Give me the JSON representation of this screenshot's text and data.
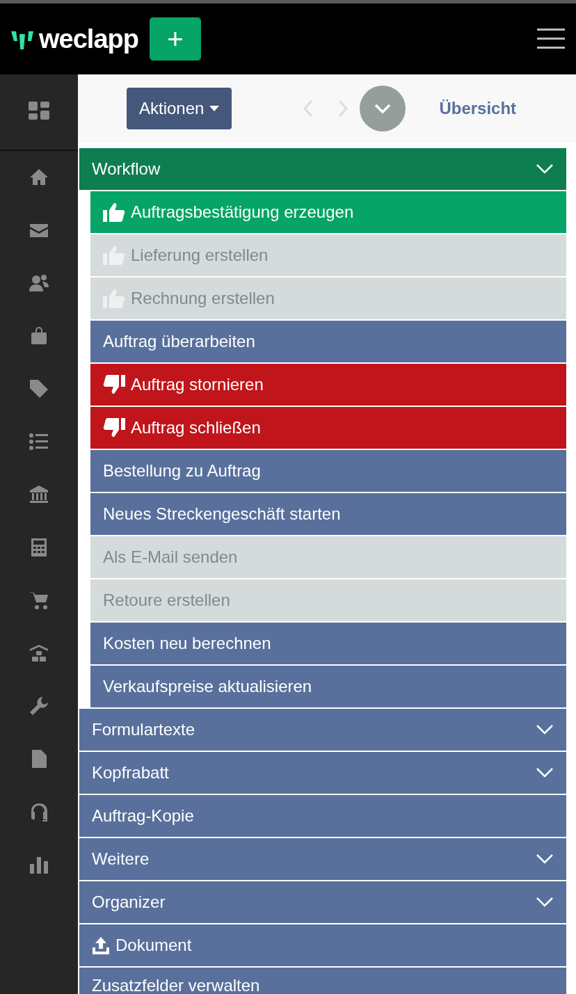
{
  "header": {
    "logo": "weclapp",
    "add_button": "+"
  },
  "toolbar": {
    "actions_button": "Aktionen",
    "previous_disabled": true,
    "next_disabled": true,
    "overview_link": "Übersicht"
  },
  "sections": [
    {
      "label": "Workflow",
      "collapsible": true,
      "expanded": true,
      "children": [
        {
          "label": "Auftragsbestätigung erzeugen",
          "kind": "approve",
          "disabled": false
        },
        {
          "label": "Lieferung erstellen",
          "kind": "approve",
          "disabled": true
        },
        {
          "label": "Rechnung erstellen",
          "kind": "approve",
          "disabled": true
        },
        {
          "label": "Auftrag überarbeiten",
          "kind": "primary",
          "disabled": false
        },
        {
          "label": "Auftrag stornieren",
          "kind": "reject",
          "disabled": false
        },
        {
          "label": "Auftrag schließen",
          "kind": "reject",
          "disabled": false
        },
        {
          "label": "Bestellung zu Auftrag",
          "kind": "primary",
          "disabled": false
        },
        {
          "label": "Neues Streckengeschäft starten",
          "kind": "primary",
          "disabled": false
        },
        {
          "label": "Als E-Mail senden",
          "kind": "primary",
          "disabled": true
        },
        {
          "label": "Retoure erstellen",
          "kind": "primary",
          "disabled": true
        },
        {
          "label": "Kosten neu berechnen",
          "kind": "primary",
          "disabled": false
        },
        {
          "label": "Verkaufspreise aktualisieren",
          "kind": "primary",
          "disabled": false
        }
      ]
    },
    {
      "label": "Formulartexte",
      "collapsible": true,
      "expanded": false
    },
    {
      "label": "Kopfrabatt",
      "collapsible": true,
      "expanded": false
    },
    {
      "label": "Auftrag-Kopie",
      "collapsible": false,
      "expanded": false
    },
    {
      "label": "Weitere",
      "collapsible": true,
      "expanded": false
    },
    {
      "label": "Organizer",
      "collapsible": true,
      "expanded": false
    },
    {
      "label": "Dokument",
      "kind": "upload",
      "collapsible": false,
      "expanded": false
    },
    {
      "label": "Zusatzfelder verwalten",
      "collapsible": false,
      "expanded": false
    }
  ]
}
